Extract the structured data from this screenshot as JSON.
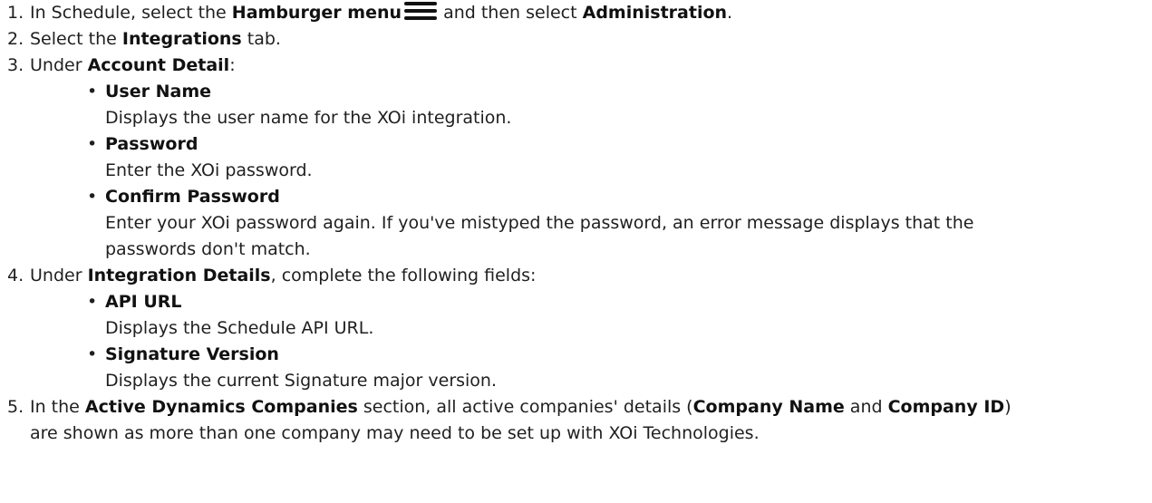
{
  "steps": [
    {
      "num": "1.",
      "t1": "In Schedule, select the ",
      "b1": "Hamburger menu",
      "icon": "hamburger-menu-icon",
      "t2": " and then select ",
      "b2": "Administration",
      "t3": "."
    },
    {
      "num": "2.",
      "t1": "Select the ",
      "b1": "Integrations",
      "t2": " tab."
    },
    {
      "num": "3.",
      "t1": "Under ",
      "b1": "Account Detail",
      "t2": ":",
      "items": [
        {
          "bullet": "•",
          "title": "User Name",
          "desc": "Displays the user name for the XOi integration."
        },
        {
          "bullet": "•",
          "title": "Password",
          "desc": "Enter the XOi password."
        },
        {
          "bullet": "•",
          "title": "Confirm Password",
          "desc_lines": [
            "Enter your XOi password again. If you've mistyped the password, an error message displays that the",
            "passwords don't match."
          ]
        }
      ]
    },
    {
      "num": "4.",
      "t1": "Under ",
      "b1": "Integration Details",
      "t2": ", complete the following fields:",
      "items": [
        {
          "bullet": "•",
          "title": "API URL",
          "desc": "Displays the Schedule API URL."
        },
        {
          "bullet": "•",
          "title": "Signature Version",
          "desc": "Displays the current Signature major version."
        }
      ]
    },
    {
      "num": "5.",
      "t1": "In the ",
      "b1": "Active Dynamics Companies",
      "t2": " section, all active companies' details (",
      "b2": "Company Name",
      "t3": " and ",
      "b3": "Company ID",
      "t4": ")",
      "line2": "are shown as more than one company may need to be set up with XOi Technologies."
    }
  ]
}
